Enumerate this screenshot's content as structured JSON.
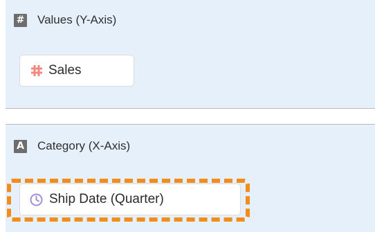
{
  "values_section": {
    "icon": "number-type-icon",
    "badge_glyph": "#",
    "title": "Values (Y-Axis)",
    "field": {
      "label": "Sales",
      "icon": "hash-icon",
      "icon_color": "#f08a80"
    }
  },
  "category_section": {
    "icon": "text-type-icon",
    "badge_glyph": "A",
    "title": "Category (X-Axis)",
    "field": {
      "label": "Ship Date (Quarter)",
      "icon": "clock-icon",
      "icon_color": "#a48ed6",
      "highlighted": true,
      "highlight_color": "#f08d1c"
    }
  },
  "colors": {
    "section_background": "#e6f0fb",
    "divider": "#b9b9b9",
    "badge": "#6d6d6d"
  }
}
